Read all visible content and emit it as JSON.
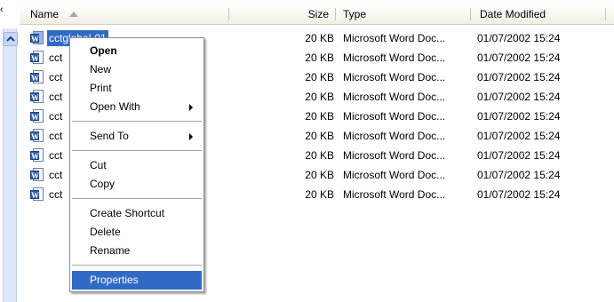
{
  "columns": {
    "name": "Name",
    "size": "Size",
    "type": "Type",
    "date": "Date Modified"
  },
  "icons": {
    "file": "word-document-icon",
    "sort": "sort-ascending-arrow-icon",
    "collapse": "chevron-up-icon"
  },
  "selected_label": "cctglobal-01",
  "rows": [
    {
      "name": "cctglobal-01",
      "size": "20 KB",
      "type": "Microsoft Word Doc...",
      "date": "01/07/2002 15:24"
    },
    {
      "name": "cct",
      "size": "20 KB",
      "type": "Microsoft Word Doc...",
      "date": "01/07/2002 15:24"
    },
    {
      "name": "cct",
      "size": "20 KB",
      "type": "Microsoft Word Doc...",
      "date": "01/07/2002 15:24"
    },
    {
      "name": "cct",
      "size": "20 KB",
      "type": "Microsoft Word Doc...",
      "date": "01/07/2002 15:24"
    },
    {
      "name": "cct",
      "size": "20 KB",
      "type": "Microsoft Word Doc...",
      "date": "01/07/2002 15:24"
    },
    {
      "name": "cct",
      "size": "20 KB",
      "type": "Microsoft Word Doc...",
      "date": "01/07/2002 15:24"
    },
    {
      "name": "cct",
      "size": "20 KB",
      "type": "Microsoft Word Doc...",
      "date": "01/07/2002 15:24"
    },
    {
      "name": "cct",
      "size": "20 KB",
      "type": "Microsoft Word Doc...",
      "date": "01/07/2002 15:24"
    },
    {
      "name": "cct",
      "size": "20 KB",
      "type": "Microsoft Word Doc...",
      "date": "01/07/2002 15:24"
    }
  ],
  "context_menu": {
    "open": "Open",
    "new": "New",
    "print": "Print",
    "open_with": "Open With",
    "send_to": "Send To",
    "cut": "Cut",
    "copy": "Copy",
    "create_shortcut": "Create Shortcut",
    "delete": "Delete",
    "rename": "Rename",
    "properties": "Properties"
  },
  "colors": {
    "selection": "#316ac5",
    "header_bg": "#f1efe3",
    "menu_border": "#8d8d8d"
  }
}
